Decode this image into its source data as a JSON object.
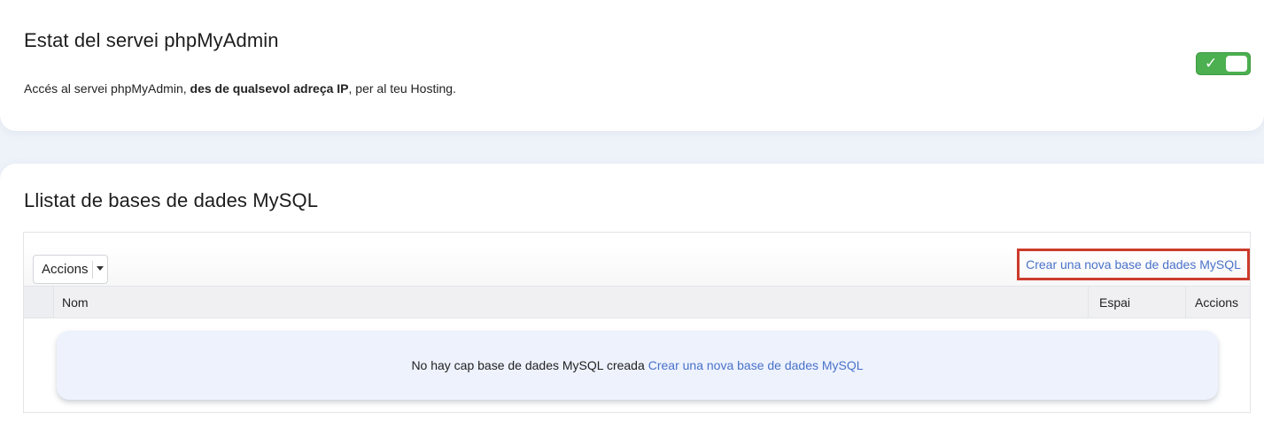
{
  "status_section": {
    "title": "Estat del servei phpMyAdmin",
    "description_prefix": "Accés al servei phpMyAdmin, ",
    "description_bold": "des de qualsevol adreça IP",
    "description_suffix": ", per al teu Hosting.",
    "toggle_check_glyph": "✓"
  },
  "list_section": {
    "title": "Llistat de bases de dades MySQL",
    "actions_button_label": "Accions",
    "create_link": "Crear una nova base de dades MySQL",
    "columns": {
      "name": "Nom",
      "space": "Espai",
      "actions": "Accions"
    },
    "empty_message": "No hay cap base de dades MySQL creada",
    "empty_create_link": "Crear una nova base de dades MySQL"
  },
  "colors": {
    "toggle_on": "#4caf50",
    "link": "#4a72c9",
    "highlight_border": "#cc3b2b"
  }
}
